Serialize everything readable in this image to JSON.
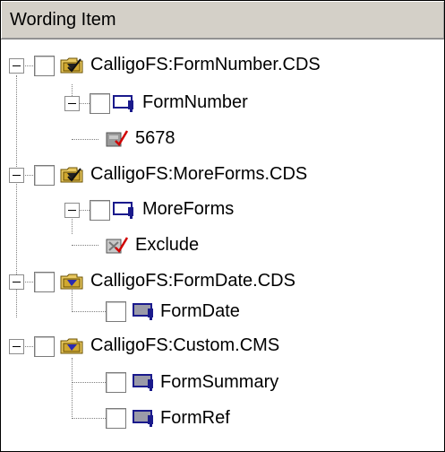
{
  "header": {
    "title": "Wording Item"
  },
  "tree": {
    "items": [
      {
        "label": "CalligoFS:FormNumber.CDS",
        "icon": "folder-form-icon"
      },
      {
        "label": "FormNumber",
        "icon": "field-icon"
      },
      {
        "label": "5678",
        "icon": "value-icon"
      },
      {
        "label": "CalligoFS:MoreForms.CDS",
        "icon": "folder-form-icon"
      },
      {
        "label": "MoreForms",
        "icon": "field-icon"
      },
      {
        "label": "Exclude",
        "icon": "value-icon"
      },
      {
        "label": "CalligoFS:FormDate.CDS",
        "icon": "folder-form-icon"
      },
      {
        "label": "FormDate",
        "icon": "field-icon"
      },
      {
        "label": "CalligoFS:Custom.CMS",
        "icon": "folder-form-icon"
      },
      {
        "label": "FormSummary",
        "icon": "field-icon"
      },
      {
        "label": "FormRef",
        "icon": "field-icon"
      }
    ]
  }
}
